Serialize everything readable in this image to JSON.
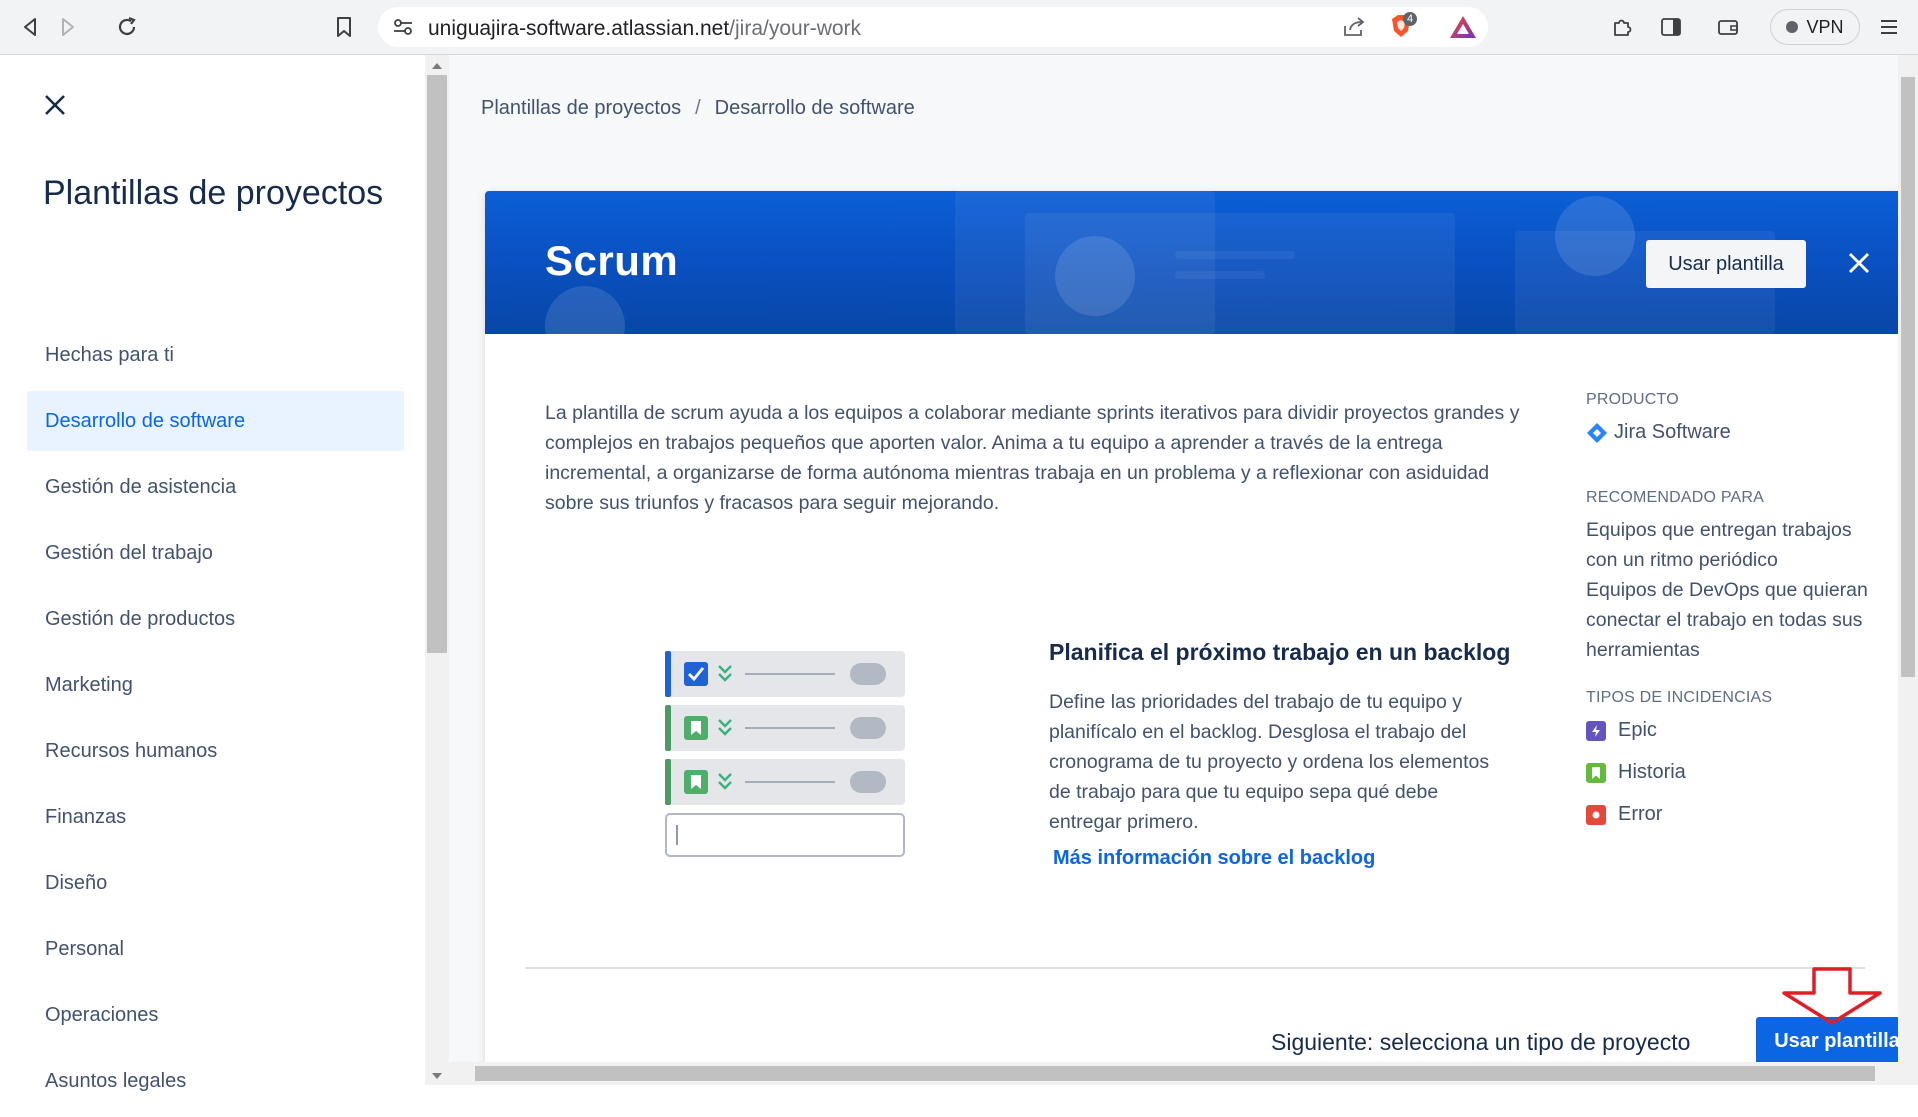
{
  "browser": {
    "url_host": "uniguajira-software.atlassian.net",
    "url_path": "/jira/your-work",
    "vpn_label": "VPN",
    "shield_badge": "4"
  },
  "sidebar": {
    "title": "Plantillas de proyectos",
    "items": [
      {
        "label": "Hechas para ti"
      },
      {
        "label": "Desarrollo de software",
        "active": true
      },
      {
        "label": "Gestión de asistencia"
      },
      {
        "label": "Gestión del trabajo"
      },
      {
        "label": "Gestión de productos"
      },
      {
        "label": "Marketing"
      },
      {
        "label": "Recursos humanos"
      },
      {
        "label": "Finanzas"
      },
      {
        "label": "Diseño"
      },
      {
        "label": "Personal"
      },
      {
        "label": "Operaciones"
      },
      {
        "label": "Asuntos legales"
      }
    ]
  },
  "breadcrumb": {
    "root": "Plantillas de proyectos",
    "separator": "/",
    "current": "Desarrollo de software"
  },
  "template": {
    "title": "Scrum",
    "use_button": "Usar plantilla",
    "description": "La plantilla de scrum ayuda a los equipos a colaborar mediante sprints iterativos para dividir proyectos grandes y complejos en trabajos pequeños que aporten valor. Anima a tu equipo a aprender a través de la entrega incremental, a organizarse de forma autónoma mientras trabaja en un problema y a reflexionar con asiduidad sobre sus triunfos y fracasos para seguir mejorando.",
    "feature": {
      "title": "Planifica el próximo trabajo en un backlog",
      "description": "Define las prioridades del trabajo de tu equipo y planifícalo en el backlog. Desglosa el trabajo del cronograma de tu proyecto y ordena los elementos de trabajo para que tu equipo sepa qué debe entregar primero.",
      "link": "Más información sobre el backlog"
    },
    "product_heading": "PRODUCTO",
    "product_name": "Jira Software",
    "recommended_heading": "RECOMENDADO PARA",
    "recommended": [
      "Equipos que entregan trabajos con un ritmo periódico",
      "Equipos de DevOps que quieran conectar el trabajo en todas sus herramientas"
    ],
    "issue_types_heading": "TIPOS DE INCIDENCIAS",
    "issue_types": [
      {
        "label": "Epic",
        "color": "#6554c0"
      },
      {
        "label": "Historia",
        "color": "#63ba3c"
      },
      {
        "label": "Error",
        "color": "#e5493a"
      }
    ]
  },
  "footer": {
    "next_text": "Siguiente: selecciona un tipo de proyecto",
    "use_button": "Usar plantilla"
  },
  "colors": {
    "primary": "#0c66e4",
    "banner": "#0b5fd7",
    "annotation": "#e01e26"
  }
}
